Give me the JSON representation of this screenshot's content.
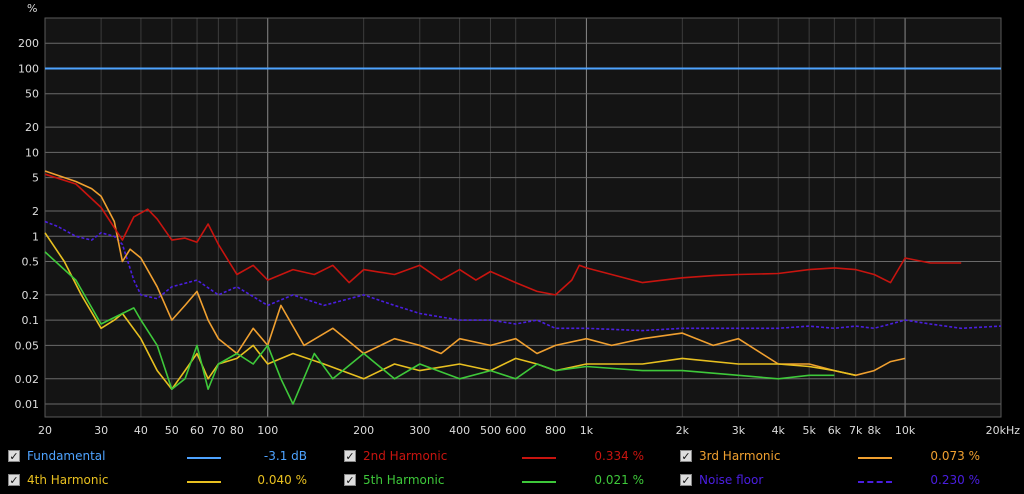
{
  "chart_data": {
    "type": "line",
    "x_scale": "log",
    "y_scale": "log",
    "y_unit_label": "%",
    "xlim": [
      20,
      20000
    ],
    "ylim": [
      0.007,
      400
    ],
    "grid": true,
    "legend_placement": "bottom",
    "x_ticks": [
      {
        "v": 20,
        "label": "20"
      },
      {
        "v": 30,
        "label": "30"
      },
      {
        "v": 40,
        "label": "40"
      },
      {
        "v": 50,
        "label": "50"
      },
      {
        "v": 60,
        "label": "60"
      },
      {
        "v": 70,
        "label": "70"
      },
      {
        "v": 80,
        "label": "80"
      },
      {
        "v": 100,
        "label": "100"
      },
      {
        "v": 200,
        "label": "200"
      },
      {
        "v": 300,
        "label": "300"
      },
      {
        "v": 400,
        "label": "400"
      },
      {
        "v": 500,
        "label": "500"
      },
      {
        "v": 600,
        "label": "600"
      },
      {
        "v": 800,
        "label": "800"
      },
      {
        "v": 1000,
        "label": "1k"
      },
      {
        "v": 2000,
        "label": "2k"
      },
      {
        "v": 3000,
        "label": "3k"
      },
      {
        "v": 4000,
        "label": "4k"
      },
      {
        "v": 5000,
        "label": "5k"
      },
      {
        "v": 6000,
        "label": "6k"
      },
      {
        "v": 7000,
        "label": "7k"
      },
      {
        "v": 8000,
        "label": "8k"
      },
      {
        "v": 10000,
        "label": "10k"
      },
      {
        "v": 20000,
        "label": "20kHz"
      }
    ],
    "y_ticks": [
      {
        "v": 200,
        "label": "200"
      },
      {
        "v": 100,
        "label": "100"
      },
      {
        "v": 50,
        "label": "50"
      },
      {
        "v": 20,
        "label": "20"
      },
      {
        "v": 10,
        "label": "10"
      },
      {
        "v": 5,
        "label": "5"
      },
      {
        "v": 2,
        "label": "2"
      },
      {
        "v": 1,
        "label": "1"
      },
      {
        "v": 0.5,
        "label": "0.5"
      },
      {
        "v": 0.2,
        "label": "0.2"
      },
      {
        "v": 0.1,
        "label": "0.1"
      },
      {
        "v": 0.05,
        "label": "0.05"
      },
      {
        "v": 0.02,
        "label": "0.02"
      },
      {
        "v": 0.01,
        "label": "0.01"
      }
    ],
    "series": [
      {
        "name": "Fundamental",
        "color": "#4ea3ff",
        "style": "solid",
        "value_label": "-3.1 dB",
        "points": [
          [
            20,
            100
          ],
          [
            20000,
            100
          ]
        ]
      },
      {
        "name": "2nd Harmonic",
        "color": "#c8140f",
        "style": "solid",
        "value_label": "0.334 %",
        "points": [
          [
            20,
            5.5
          ],
          [
            25,
            4.2
          ],
          [
            30,
            2.2
          ],
          [
            35,
            0.9
          ],
          [
            38,
            1.7
          ],
          [
            42,
            2.1
          ],
          [
            45,
            1.6
          ],
          [
            50,
            0.9
          ],
          [
            55,
            0.95
          ],
          [
            60,
            0.85
          ],
          [
            65,
            1.4
          ],
          [
            70,
            0.8
          ],
          [
            80,
            0.35
          ],
          [
            90,
            0.45
          ],
          [
            100,
            0.3
          ],
          [
            120,
            0.4
          ],
          [
            140,
            0.35
          ],
          [
            160,
            0.45
          ],
          [
            180,
            0.28
          ],
          [
            200,
            0.4
          ],
          [
            250,
            0.35
          ],
          [
            300,
            0.45
          ],
          [
            350,
            0.3
          ],
          [
            400,
            0.4
          ],
          [
            450,
            0.3
          ],
          [
            500,
            0.38
          ],
          [
            600,
            0.28
          ],
          [
            700,
            0.22
          ],
          [
            800,
            0.2
          ],
          [
            900,
            0.3
          ],
          [
            950,
            0.45
          ],
          [
            1000,
            0.42
          ],
          [
            1200,
            0.35
          ],
          [
            1500,
            0.28
          ],
          [
            2000,
            0.32
          ],
          [
            2500,
            0.34
          ],
          [
            3000,
            0.35
          ],
          [
            4000,
            0.36
          ],
          [
            5000,
            0.4
          ],
          [
            6000,
            0.42
          ],
          [
            7000,
            0.4
          ],
          [
            8000,
            0.35
          ],
          [
            9000,
            0.28
          ],
          [
            10000,
            0.55
          ],
          [
            12000,
            0.48
          ],
          [
            15000,
            0.48
          ]
        ]
      },
      {
        "name": "3rd Harmonic",
        "color": "#f0a030",
        "style": "solid",
        "value_label": "0.073 %",
        "points": [
          [
            20,
            6
          ],
          [
            25,
            4.5
          ],
          [
            28,
            3.7
          ],
          [
            30,
            3
          ],
          [
            33,
            1.5
          ],
          [
            35,
            0.5
          ],
          [
            37,
            0.7
          ],
          [
            40,
            0.55
          ],
          [
            45,
            0.25
          ],
          [
            50,
            0.1
          ],
          [
            55,
            0.15
          ],
          [
            60,
            0.22
          ],
          [
            65,
            0.1
          ],
          [
            70,
            0.06
          ],
          [
            80,
            0.04
          ],
          [
            90,
            0.08
          ],
          [
            100,
            0.05
          ],
          [
            110,
            0.15
          ],
          [
            130,
            0.05
          ],
          [
            160,
            0.08
          ],
          [
            200,
            0.04
          ],
          [
            250,
            0.06
          ],
          [
            300,
            0.05
          ],
          [
            350,
            0.04
          ],
          [
            400,
            0.06
          ],
          [
            500,
            0.05
          ],
          [
            600,
            0.06
          ],
          [
            700,
            0.04
          ],
          [
            800,
            0.05
          ],
          [
            1000,
            0.06
          ],
          [
            1200,
            0.05
          ],
          [
            1500,
            0.06
          ],
          [
            2000,
            0.07
          ],
          [
            2500,
            0.05
          ],
          [
            3000,
            0.06
          ],
          [
            4000,
            0.03
          ],
          [
            5000,
            0.03
          ],
          [
            6000,
            0.025
          ],
          [
            7000,
            0.022
          ],
          [
            8000,
            0.025
          ],
          [
            9000,
            0.032
          ],
          [
            10000,
            0.035
          ]
        ]
      },
      {
        "name": "4th Harmonic",
        "color": "#e8c020",
        "style": "solid",
        "value_label": "0.040 %",
        "points": [
          [
            20,
            1.1
          ],
          [
            23,
            0.5
          ],
          [
            26,
            0.2
          ],
          [
            30,
            0.08
          ],
          [
            33,
            0.1
          ],
          [
            35,
            0.12
          ],
          [
            40,
            0.06
          ],
          [
            45,
            0.025
          ],
          [
            50,
            0.015
          ],
          [
            55,
            0.025
          ],
          [
            60,
            0.04
          ],
          [
            65,
            0.02
          ],
          [
            70,
            0.03
          ],
          [
            80,
            0.035
          ],
          [
            90,
            0.05
          ],
          [
            100,
            0.03
          ],
          [
            120,
            0.04
          ],
          [
            150,
            0.03
          ],
          [
            200,
            0.02
          ],
          [
            250,
            0.03
          ],
          [
            300,
            0.025
          ],
          [
            400,
            0.03
          ],
          [
            500,
            0.025
          ],
          [
            600,
            0.035
          ],
          [
            700,
            0.03
          ],
          [
            800,
            0.025
          ],
          [
            1000,
            0.03
          ],
          [
            1500,
            0.03
          ],
          [
            2000,
            0.035
          ],
          [
            3000,
            0.03
          ],
          [
            4000,
            0.03
          ],
          [
            5000,
            0.028
          ],
          [
            6000,
            0.025
          ],
          [
            7000,
            0.022
          ]
        ]
      },
      {
        "name": "5th Harmonic",
        "color": "#3ec83a",
        "style": "solid",
        "value_label": "0.021 %",
        "points": [
          [
            20,
            0.65
          ],
          [
            25,
            0.3
          ],
          [
            30,
            0.09
          ],
          [
            35,
            0.12
          ],
          [
            38,
            0.14
          ],
          [
            40,
            0.1
          ],
          [
            45,
            0.05
          ],
          [
            50,
            0.015
          ],
          [
            55,
            0.02
          ],
          [
            60,
            0.05
          ],
          [
            65,
            0.015
          ],
          [
            70,
            0.03
          ],
          [
            80,
            0.04
          ],
          [
            90,
            0.03
          ],
          [
            100,
            0.05
          ],
          [
            110,
            0.02
          ],
          [
            120,
            0.01
          ],
          [
            140,
            0.04
          ],
          [
            160,
            0.02
          ],
          [
            200,
            0.04
          ],
          [
            250,
            0.02
          ],
          [
            300,
            0.03
          ],
          [
            400,
            0.02
          ],
          [
            500,
            0.025
          ],
          [
            600,
            0.02
          ],
          [
            700,
            0.03
          ],
          [
            800,
            0.025
          ],
          [
            1000,
            0.028
          ],
          [
            1500,
            0.025
          ],
          [
            2000,
            0.025
          ],
          [
            3000,
            0.022
          ],
          [
            4000,
            0.02
          ],
          [
            5000,
            0.022
          ],
          [
            6000,
            0.022
          ]
        ]
      },
      {
        "name": "Noise floor",
        "color": "#4a1ee0",
        "style": "dashed",
        "value_label": "0.230 %",
        "points": [
          [
            20,
            1.5
          ],
          [
            22,
            1.3
          ],
          [
            25,
            1.0
          ],
          [
            28,
            0.9
          ],
          [
            30,
            1.1
          ],
          [
            33,
            1.0
          ],
          [
            35,
            0.8
          ],
          [
            38,
            0.3
          ],
          [
            40,
            0.2
          ],
          [
            45,
            0.18
          ],
          [
            50,
            0.25
          ],
          [
            60,
            0.3
          ],
          [
            70,
            0.2
          ],
          [
            80,
            0.25
          ],
          [
            100,
            0.15
          ],
          [
            120,
            0.2
          ],
          [
            150,
            0.15
          ],
          [
            200,
            0.2
          ],
          [
            250,
            0.15
          ],
          [
            300,
            0.12
          ],
          [
            400,
            0.1
          ],
          [
            500,
            0.1
          ],
          [
            600,
            0.09
          ],
          [
            700,
            0.1
          ],
          [
            800,
            0.08
          ],
          [
            1000,
            0.08
          ],
          [
            1500,
            0.075
          ],
          [
            2000,
            0.08
          ],
          [
            3000,
            0.08
          ],
          [
            4000,
            0.08
          ],
          [
            5000,
            0.085
          ],
          [
            6000,
            0.08
          ],
          [
            7000,
            0.085
          ],
          [
            8000,
            0.08
          ],
          [
            9000,
            0.09
          ],
          [
            10000,
            0.1
          ],
          [
            12000,
            0.09
          ],
          [
            15000,
            0.08
          ],
          [
            20000,
            0.085
          ]
        ]
      }
    ]
  }
}
